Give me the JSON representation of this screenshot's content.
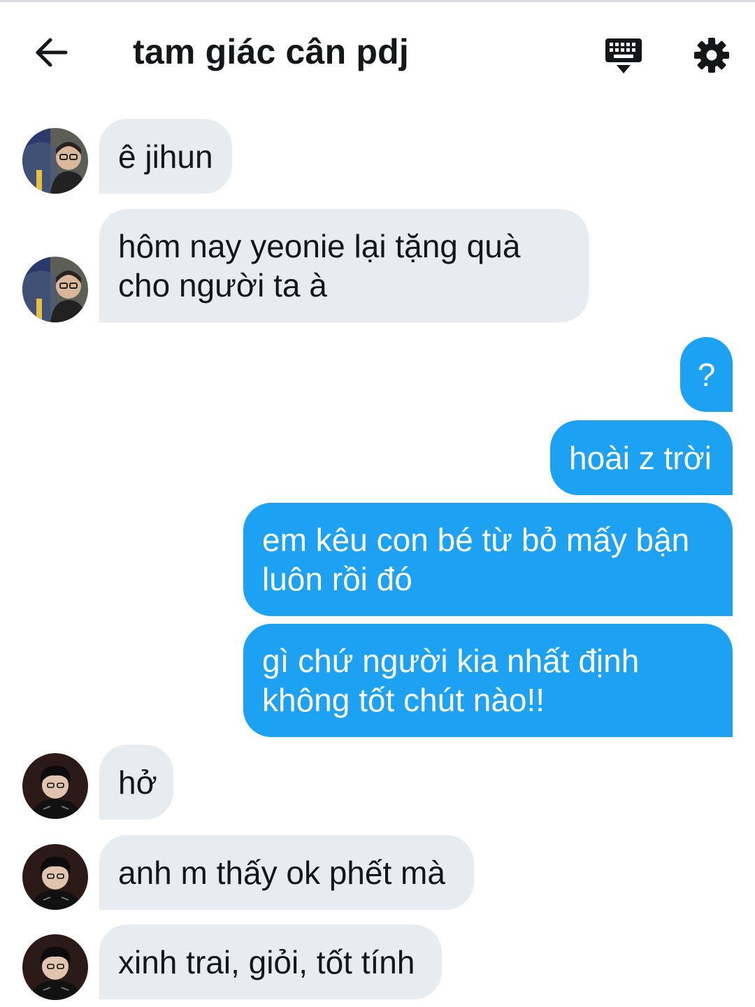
{
  "header": {
    "title": "tam giác cân pdj",
    "back_icon": "arrow-left-icon",
    "keyboard_icon": "keyboard-icon",
    "settings_icon": "gear-icon"
  },
  "colors": {
    "sent_bubble": "#1da1f2",
    "received_bubble": "#e6ecf0",
    "text_primary": "#14171a"
  },
  "messages": [
    {
      "from": "other",
      "text": "ê jihun",
      "avatar": "avatar-glasses-umbrella"
    },
    {
      "from": "other",
      "text": "hôm nay yeonie lại tặng quà\ncho người ta à",
      "avatar": "avatar-glasses-umbrella"
    },
    {
      "from": "me",
      "text": "?"
    },
    {
      "from": "me",
      "text": "hoài z trời"
    },
    {
      "from": "me",
      "text": "em kêu con bé từ bỏ mấy bận\nluôn rồi đó"
    },
    {
      "from": "me",
      "text": "gì chứ người kia nhất định\nkhông tốt chút nào!!"
    },
    {
      "from": "other",
      "text": "hở",
      "avatar": "avatar-dark-hair"
    },
    {
      "from": "other",
      "text": "anh m thấy ok phết mà",
      "avatar": "avatar-dark-hair"
    },
    {
      "from": "other",
      "text": "xinh trai, giỏi, tốt tính",
      "avatar": "avatar-dark-hair"
    }
  ]
}
